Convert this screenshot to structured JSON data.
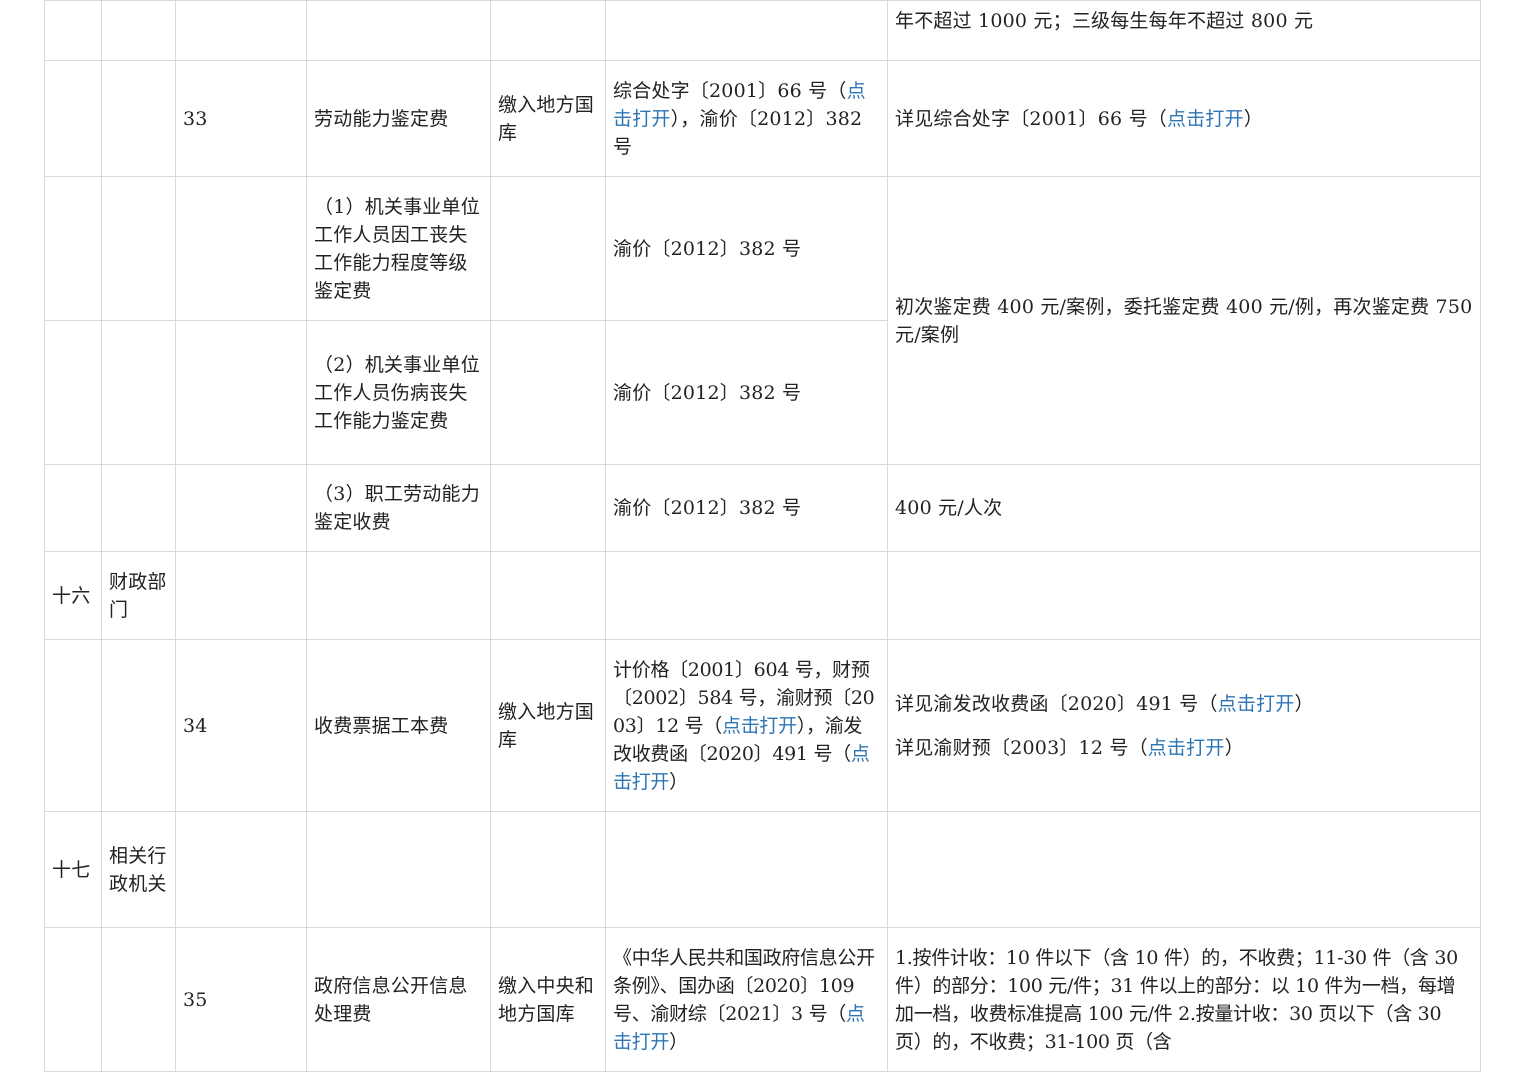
{
  "rows": {
    "continuation": {
      "standard": "年不超过 1000 元；三级每生每年不超过 800 元"
    },
    "item33": {
      "no": "33",
      "name": "劳动能力鉴定费",
      "treasury": "缴入地方国库",
      "basis_a": "综合处字〔2001〕66 号（",
      "basis_link": "点击打开",
      "basis_b": "），渝价〔2012〕382 号",
      "standard_a": "详见综合处字〔2001〕66 号（",
      "standard_link": "点击打开",
      "standard_b": "）"
    },
    "item33_1": {
      "name": "（1）机关事业单位工作人员因工丧失工作能力程度等级鉴定费",
      "basis": "渝价〔2012〕382 号"
    },
    "item33_2": {
      "name": "（2）机关事业单位工作人员伤病丧失工作能力鉴定费",
      "basis": "渝价〔2012〕382 号"
    },
    "item33_12_standard": "初次鉴定费 400 元/案例，委托鉴定费 400 元/例，再次鉴定费 750 元/案例",
    "item33_3": {
      "name": "（3）职工劳动能力鉴定收费",
      "basis": "渝价〔2012〕382 号",
      "standard": "400 元/人次"
    },
    "dept16": {
      "no": "十六",
      "name": "财政部门"
    },
    "item34": {
      "no": "34",
      "name": "收费票据工本费",
      "treasury": "缴入地方国库",
      "basis_a": "计价格〔2001〕604 号，财预〔2002〕584 号，渝财预〔2003〕12 号（",
      "basis_link1": "点击打开",
      "basis_b": "），渝发改收费函〔2020〕491 号（",
      "basis_link2": "点击打开",
      "basis_c": "）",
      "standard1_a": "详见渝发改收费函〔2020〕491 号（",
      "standard1_link": "点击打开",
      "standard1_b": "）",
      "standard2_a": "详见渝财预〔2003〕12 号（",
      "standard2_link": "点击打开",
      "standard2_b": "）"
    },
    "dept17": {
      "no": "十七",
      "name": "相关行政机关"
    },
    "item35": {
      "no": "35",
      "name": "政府信息公开信息处理费",
      "treasury": "缴入中央和地方国库",
      "basis_a": "《中华人民共和国政府信息公开条例》、国办函〔2020〕109 号、渝财综〔2021〕3 号（",
      "basis_link": "点击打开",
      "basis_b": "）",
      "standard": "1.按件计收：10 件以下（含 10 件）的，不收费；11-30 件（含 30 件）的部分：100 元/件；31 件以上的部分：以 10 件为一档，每增加一档，收费标准提高 100 元/件 2.按量计收：30 页以下（含 30 页）的，不收费；31-100 页（含"
    }
  },
  "colors": {
    "link": "#2e75b6",
    "border": "#d9d9d9",
    "text": "#222222"
  }
}
